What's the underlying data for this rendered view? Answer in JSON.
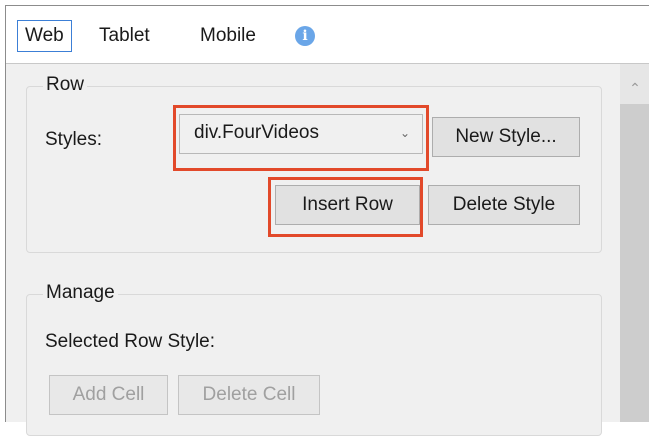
{
  "tabs": [
    {
      "label": "Web",
      "active": true
    },
    {
      "label": "Tablet",
      "active": false
    },
    {
      "label": "Mobile",
      "active": false
    }
  ],
  "info_icon": {
    "name": "info-icon",
    "glyph": "i"
  },
  "row_group": {
    "title": "Row",
    "styles_label": "Styles:",
    "styles_select": {
      "selected": "div.FourVideos"
    },
    "new_style_label": "New Style...",
    "insert_row_label": "Insert Row",
    "delete_style_label": "Delete Style"
  },
  "manage_group": {
    "title": "Manage",
    "selected_row_style_label": "Selected Row Style:",
    "add_cell_label": "Add Cell",
    "delete_cell_label": "Delete Cell"
  },
  "colors": {
    "highlight": "#e2492a",
    "active_tab_border": "#3c7fd6",
    "info_icon": "#6aa6e8"
  }
}
